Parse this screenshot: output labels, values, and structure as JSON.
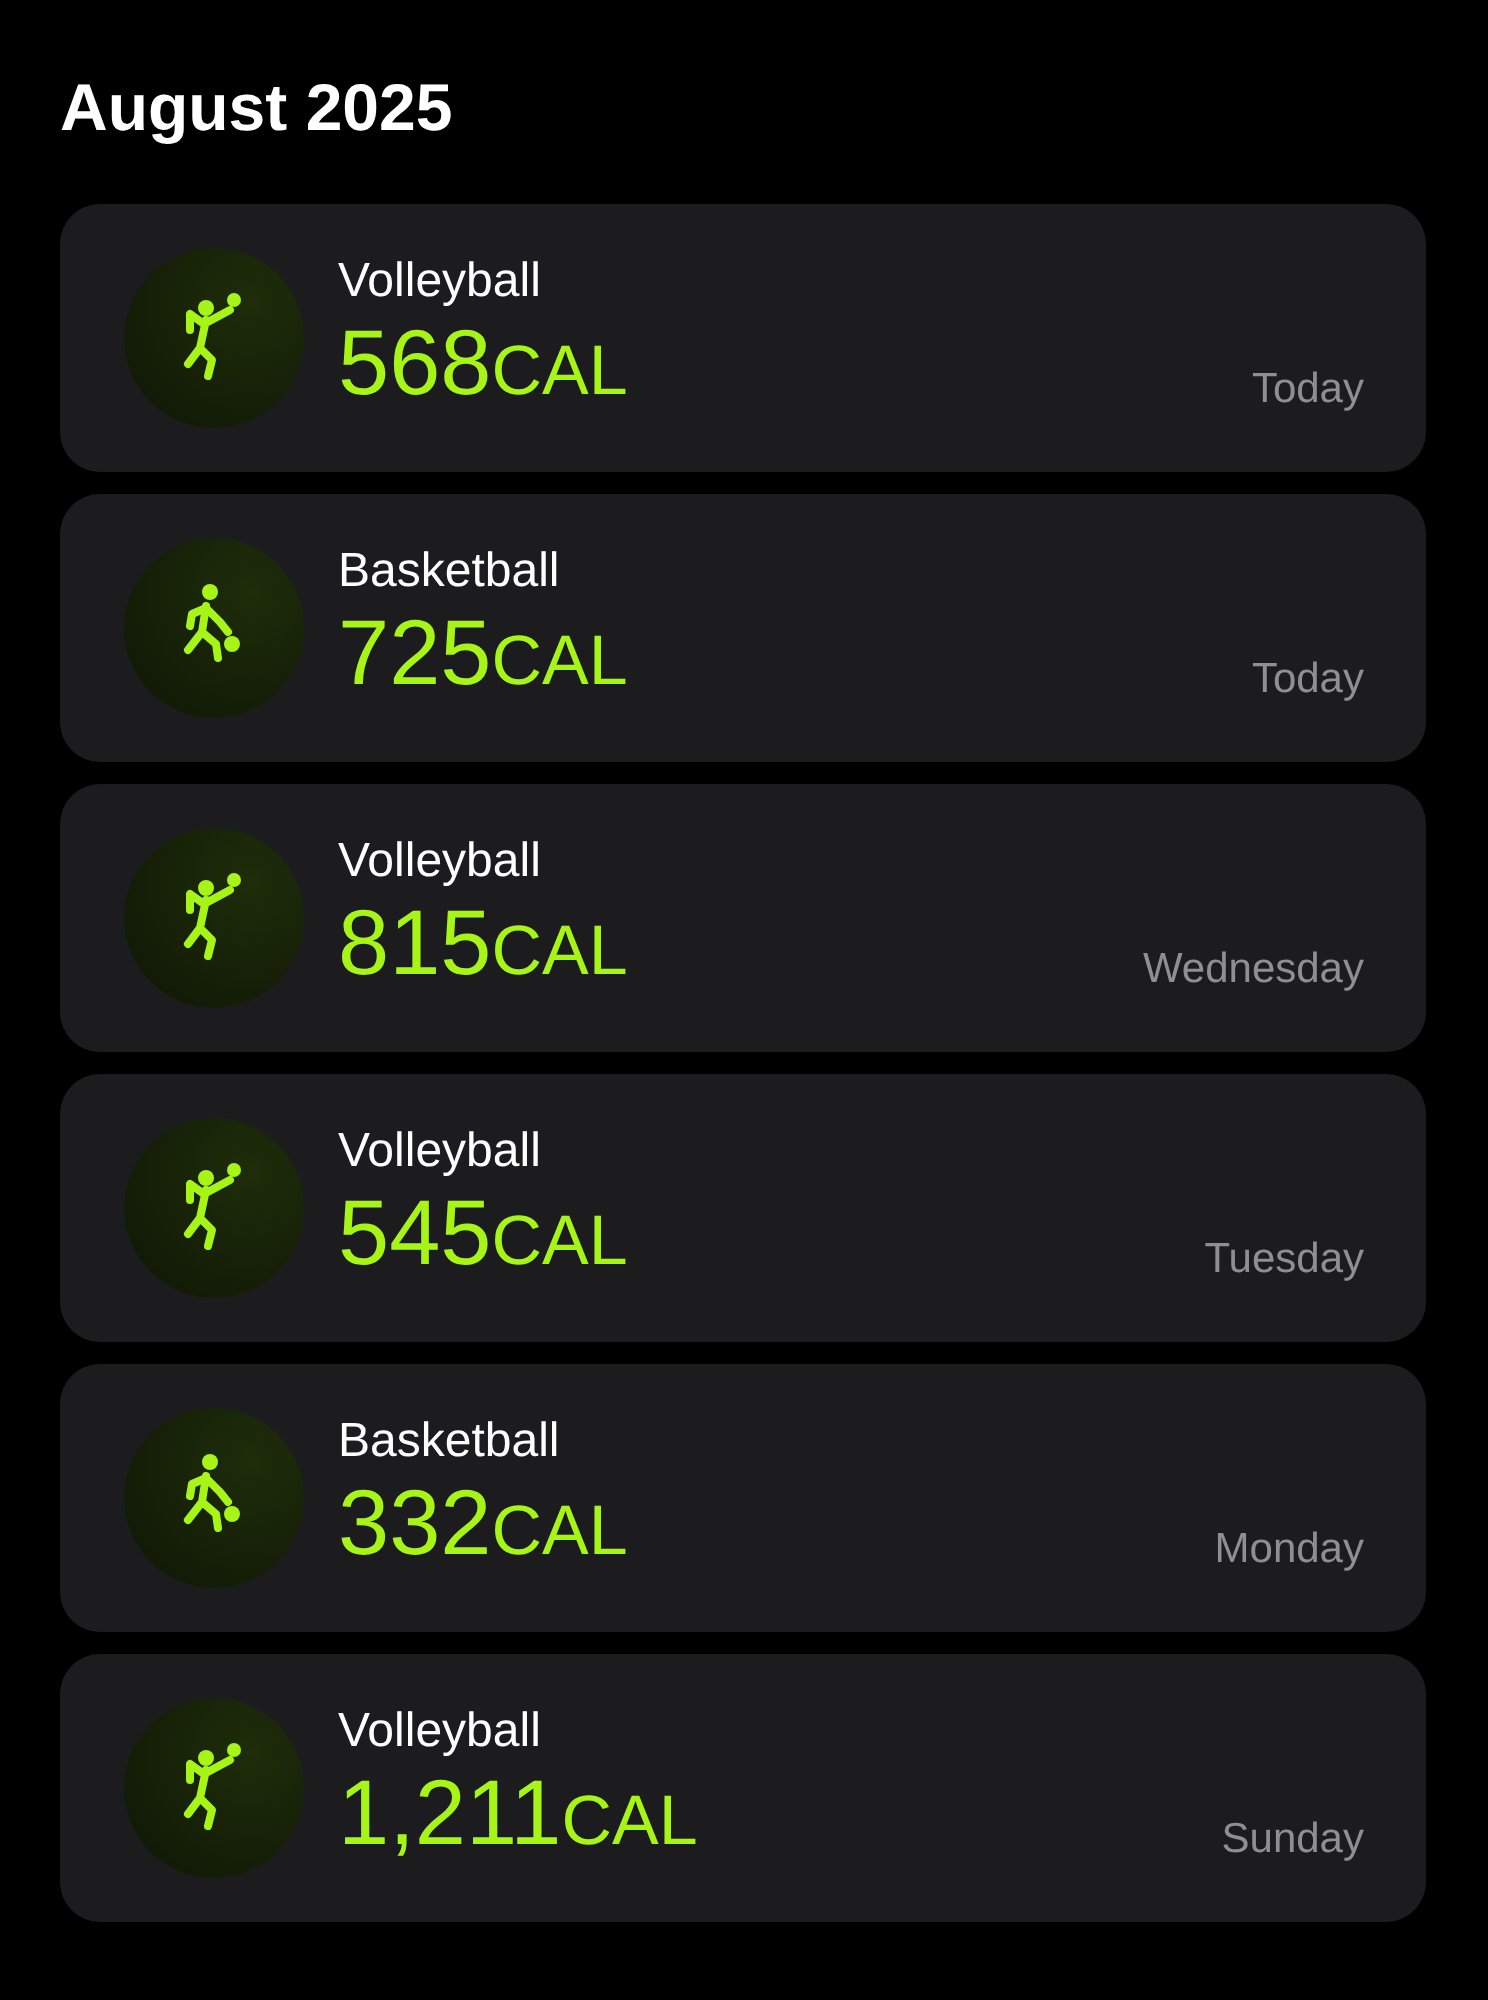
{
  "title": "August 2025",
  "workouts": [
    {
      "kind": "volleyball",
      "name": "Volleyball",
      "value": "568",
      "unit": "CAL",
      "day": "Today"
    },
    {
      "kind": "basketball",
      "name": "Basketball",
      "value": "725",
      "unit": "CAL",
      "day": "Today"
    },
    {
      "kind": "volleyball",
      "name": "Volleyball",
      "value": "815",
      "unit": "CAL",
      "day": "Wednesday"
    },
    {
      "kind": "volleyball",
      "name": "Volleyball",
      "value": "545",
      "unit": "CAL",
      "day": "Tuesday"
    },
    {
      "kind": "basketball",
      "name": "Basketball",
      "value": "332",
      "unit": "CAL",
      "day": "Monday"
    },
    {
      "kind": "volleyball",
      "name": "Volleyball",
      "value": "1,211",
      "unit": "CAL",
      "day": "Sunday"
    }
  ]
}
